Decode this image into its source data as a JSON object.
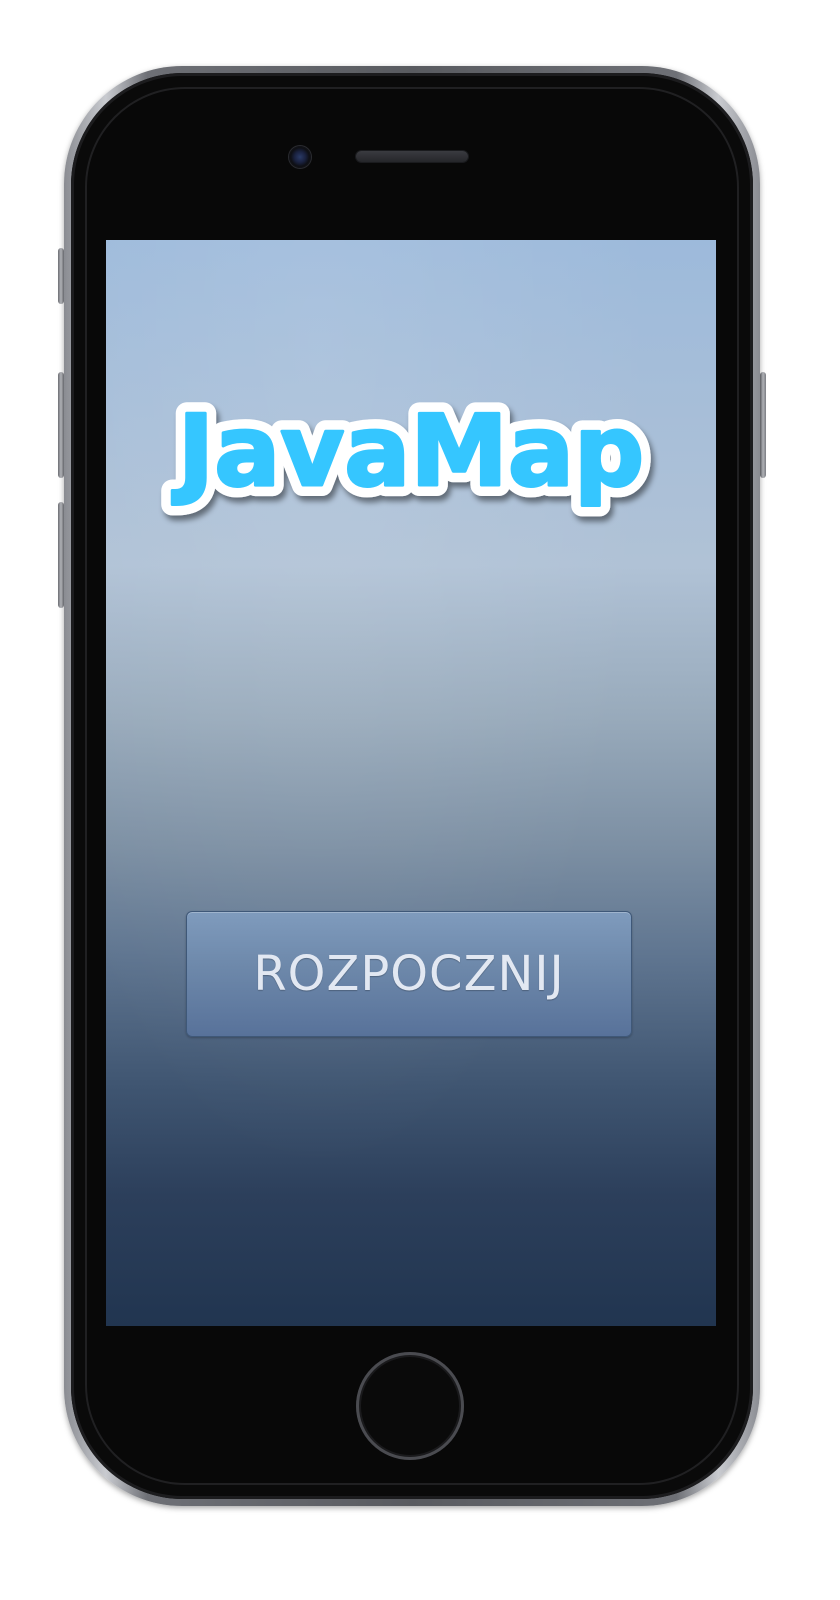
{
  "app": {
    "logo_text": "JavaMap",
    "logo_color": "#36c6ff",
    "logo_outline_color": "#ffffff"
  },
  "main": {
    "start_button_label": "ROZPOCZNIJ"
  },
  "icons": {
    "camera": "camera-icon",
    "speaker": "speaker-icon",
    "home": "home-button-icon"
  },
  "colors": {
    "screen_top": "#9dbadb",
    "screen_bottom": "#213550",
    "button_face": "#6d88aa",
    "button_text": "#e2e8f2"
  }
}
